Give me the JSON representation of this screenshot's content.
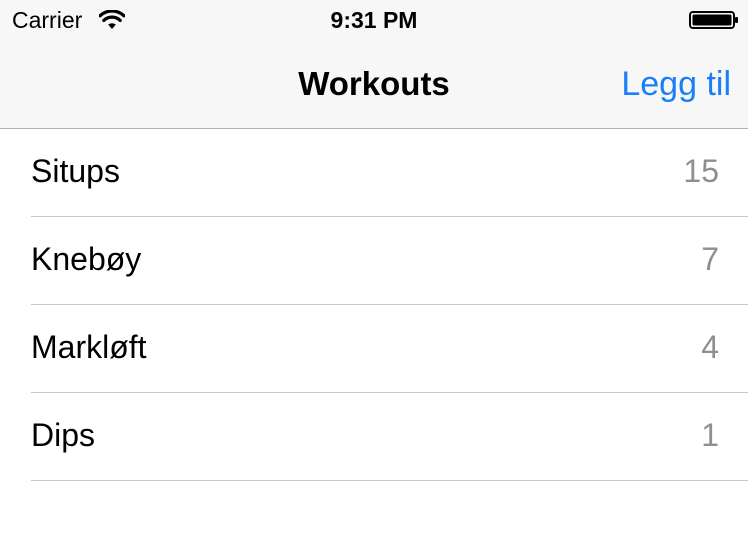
{
  "status_bar": {
    "carrier": "Carrier",
    "time": "9:31 PM",
    "wifi_icon": "wifi-icon",
    "battery_icon": "battery-icon"
  },
  "nav": {
    "title": "Workouts",
    "add_label": "Legg til"
  },
  "workouts": [
    {
      "name": "Situps",
      "count": "15"
    },
    {
      "name": "Knebøy",
      "count": "7"
    },
    {
      "name": "Markløft",
      "count": "4"
    },
    {
      "name": "Dips",
      "count": "1"
    }
  ],
  "colors": {
    "accent": "#1a7ff6",
    "nav_background": "#f7f7f7",
    "secondary_text": "#8e8e93",
    "separator": "#c8c7cc"
  }
}
